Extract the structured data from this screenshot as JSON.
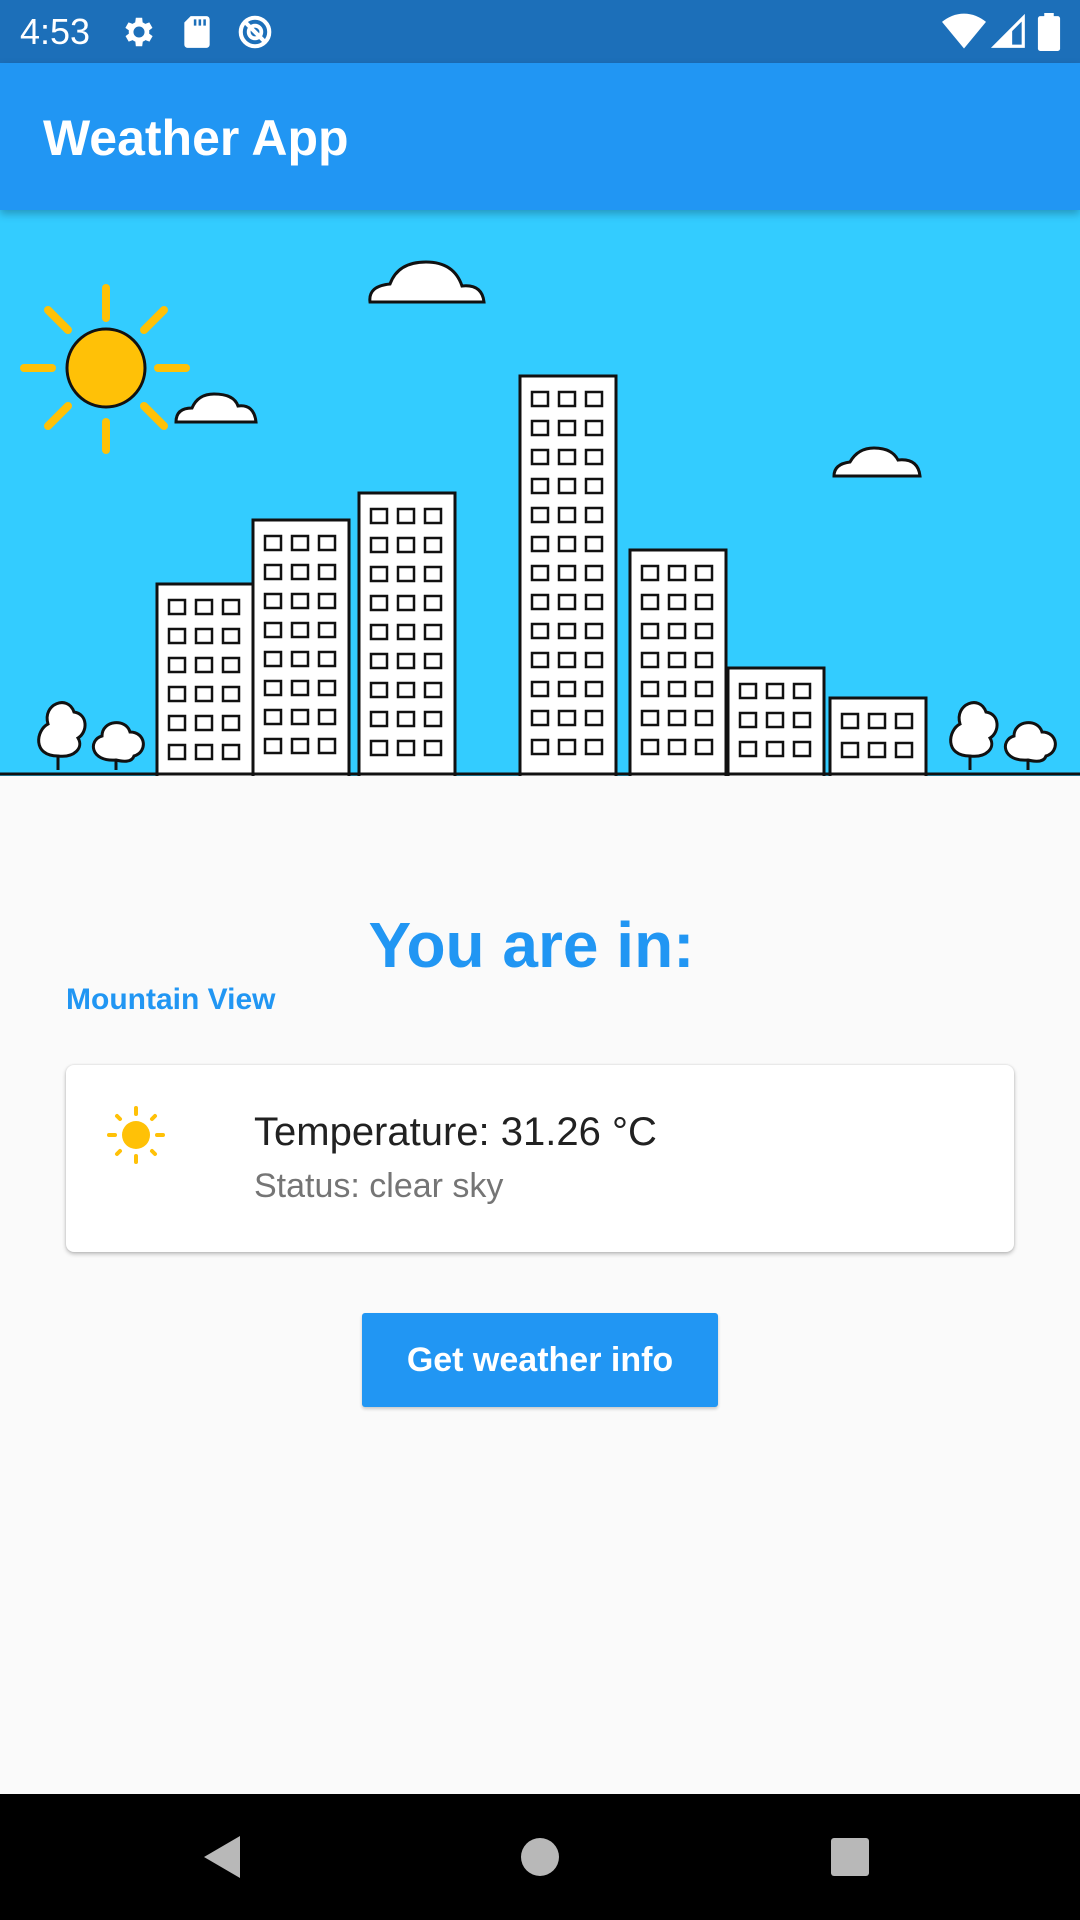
{
  "status_bar": {
    "time": "4:53",
    "icons_left": [
      "gear-icon",
      "sd-card-icon",
      "no-disturb-icon"
    ],
    "icons_right": [
      "wifi-icon",
      "cell-signal-icon",
      "battery-icon"
    ],
    "background_color": "#1c6fb9"
  },
  "app_bar": {
    "title": "Weather App",
    "background_color": "#2196f3"
  },
  "hero": {
    "description_icons": [
      "sun-icon",
      "cloud-icon",
      "building-icon",
      "tree-icon"
    ],
    "sky_color": "#33ccff"
  },
  "location": {
    "heading": "You are in:",
    "city": "Mountain View"
  },
  "weather_card": {
    "icon": "sun-icon",
    "temperature": "Temperature: 31.26 °C",
    "status": "Status: clear sky"
  },
  "actions": {
    "get_weather_label": "Get weather info"
  },
  "nav_bar": {
    "buttons": [
      "back-icon",
      "home-icon",
      "recents-icon"
    ]
  },
  "colors": {
    "accent": "#2196f3",
    "sun": "#ffc107"
  }
}
